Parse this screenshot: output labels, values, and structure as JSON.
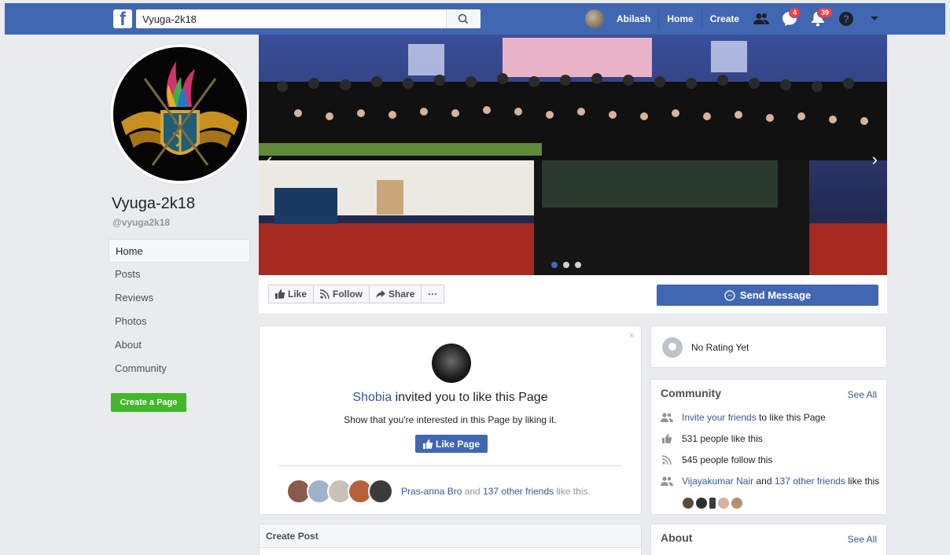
{
  "topbar": {
    "logo": "f",
    "search_value": "Vyuga-2k18",
    "user_name": "Abilash",
    "home_label": "Home",
    "create_label": "Create",
    "messages_badge": "4",
    "notifications_badge": "39"
  },
  "page": {
    "name": "Vyuga-2k18",
    "handle": "@vyuga2k18"
  },
  "side_nav": {
    "items": [
      {
        "label": "Home",
        "active": true
      },
      {
        "label": "Posts"
      },
      {
        "label": "Reviews"
      },
      {
        "label": "Photos"
      },
      {
        "label": "About"
      },
      {
        "label": "Community"
      }
    ],
    "create_page": "Create a Page"
  },
  "cover": {
    "slides": 3,
    "active_slide": 1
  },
  "actions": {
    "like": "Like",
    "follow": "Follow",
    "share": "Share",
    "more": "···",
    "send_message": "Send Message"
  },
  "invite": {
    "inviter": "Shobia",
    "title_rest": " invited you to like this Page",
    "subtitle": "Show that you're interested in this Page by liking it.",
    "like_page": "Like Page",
    "friend_name": "Pras-anna Bro",
    "and": " and ",
    "others": "137 other friends",
    "suffix": " like this."
  },
  "create_post": {
    "title": "Create Post"
  },
  "rating": {
    "text": "No Rating Yet"
  },
  "community": {
    "title": "Community",
    "see_all": "See All",
    "invite_link": "Invite your friends",
    "invite_rest": " to like this Page",
    "likes": "531 people like this",
    "follows": "545 people follow this",
    "friend_link": "Vijayakumar Nair",
    "friend_and": " and ",
    "friend_others": "137 other friends",
    "friend_rest": " like this"
  },
  "about": {
    "title": "About",
    "see_all": "See All"
  },
  "colors": {
    "brand": "#4267b2",
    "green": "#42b72a",
    "link": "#365899",
    "badge": "#fa3e3e"
  }
}
